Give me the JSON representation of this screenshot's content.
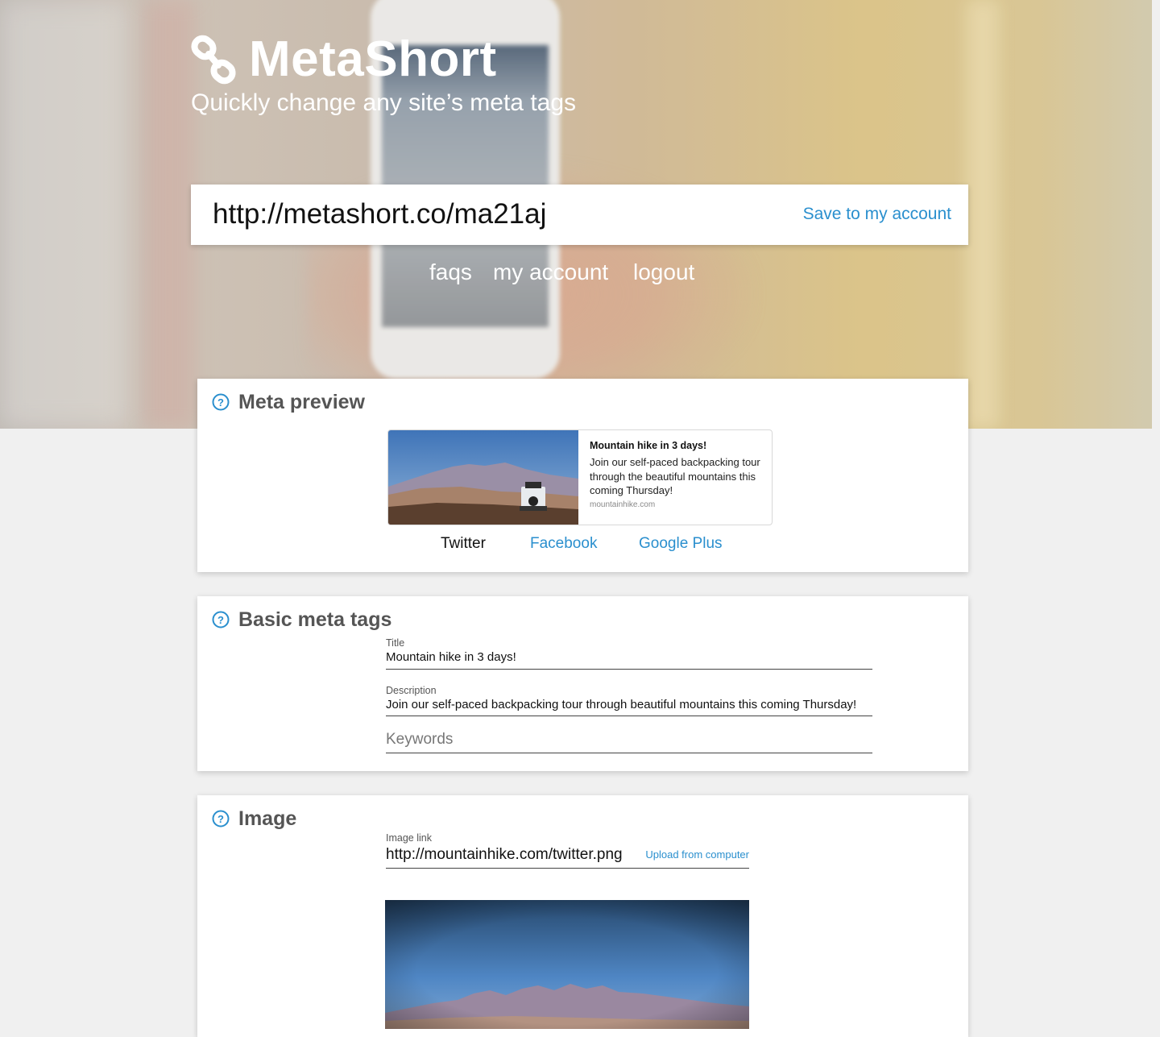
{
  "brand": {
    "name": "MetaShort",
    "tagline": "Quickly change any site’s meta tags"
  },
  "url_bar": {
    "url": "http://metashort.co/ma21aj",
    "save_label": "Save to my account"
  },
  "nav": {
    "faqs": "faqs",
    "account": "my account",
    "logout": "logout"
  },
  "meta_preview": {
    "title": "Meta preview",
    "card": {
      "title": "Mountain hike in 3 days!",
      "description": "Join our self-paced backpacking tour through the beautiful mountains this coming Thursday!",
      "domain": "mountainhike.com"
    },
    "tabs": [
      "Twitter",
      "Facebook",
      "Google Plus"
    ],
    "active_tab": "Twitter"
  },
  "basic_meta": {
    "title": "Basic meta tags",
    "title_label": "Title",
    "title_value": "Mountain hike in 3 days!",
    "description_label": "Description",
    "description_value": "Join our self-paced backpacking tour through beautiful mountains this coming Thursday!",
    "keywords_placeholder": "Keywords"
  },
  "image_section": {
    "title": "Image",
    "link_label": "Image link",
    "link_value": "http://mountainhike.com/twitter.png",
    "upload_label": "Upload from computer"
  },
  "colors": {
    "accent": "#2a8fce",
    "page_bg": "#f0f0f0",
    "card_bg": "#ffffff"
  }
}
